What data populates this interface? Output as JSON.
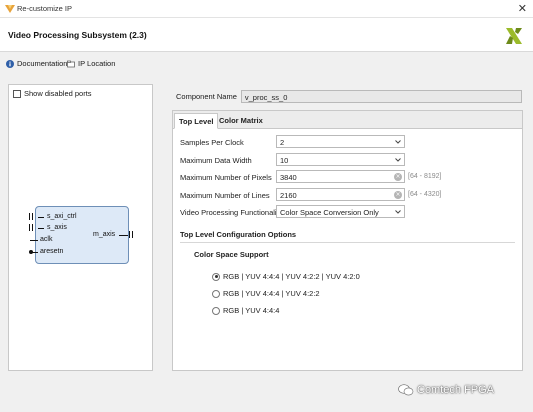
{
  "window": {
    "title": "Re-customize IP",
    "close_glyph": "✕",
    "icons": {
      "app": "vivado-app-icon",
      "close": "close-icon"
    }
  },
  "header": {
    "heading": "Video Processing Subsystem (2.3)",
    "logo": "xilinx-logo"
  },
  "links": {
    "documentation": "Documentation",
    "ip_location": "IP Location",
    "icons": {
      "documentation": "info-icon",
      "ip_location": "folder-icon"
    }
  },
  "left_panel": {
    "show_disabled_ports_label": "Show disabled ports",
    "show_disabled_ports_checked": false,
    "block": {
      "inputs": [
        "s_axi_ctrl",
        "s_axis",
        "aclk",
        "aresetn"
      ],
      "outputs": [
        "m_axis"
      ]
    }
  },
  "component": {
    "label": "Component Name",
    "value": "v_proc_ss_0"
  },
  "tabs": [
    "Top Level",
    "Color Matrix"
  ],
  "active_tab": "Top Level",
  "fields": {
    "samples_per_clock": {
      "label": "Samples Per Clock",
      "value": "2"
    },
    "max_data_width": {
      "label": "Maximum Data Width",
      "value": "10"
    },
    "max_pixels": {
      "label": "Maximum Number of Pixels",
      "value": "3840",
      "range": "[64 - 8192]"
    },
    "max_lines": {
      "label": "Maximum Number of Lines",
      "value": "2160",
      "range": "[64 - 4320]"
    },
    "functionality": {
      "label": "Video Processing Functionality",
      "value": "Color Space Conversion Only"
    }
  },
  "top_level_options": {
    "heading": "Top Level Configuration Options",
    "color_space_heading": "Color Space Support",
    "options": [
      {
        "label": "RGB | YUV 4:4:4 | YUV 4:2:2 | YUV 4:2:0",
        "selected": true
      },
      {
        "label": "RGB | YUV 4:4:4 | YUV 4:2:2",
        "selected": false
      },
      {
        "label": "RGB | YUV 4:4:4",
        "selected": false
      }
    ]
  },
  "watermark": {
    "text": "Comtech FPGA",
    "icon": "wechat-icon"
  }
}
